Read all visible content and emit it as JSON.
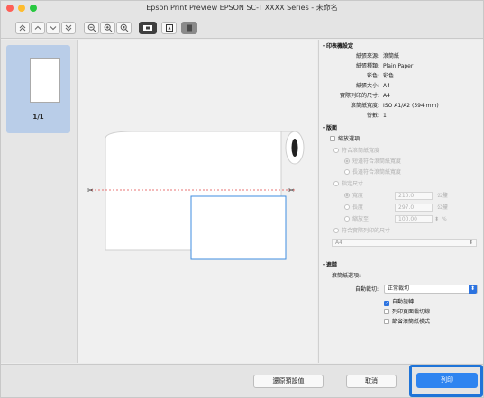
{
  "window": {
    "title": "Epson Print Preview EPSON SC-T XXXX Series - 未命名",
    "traffic_light_colors": [
      "#fe5f57",
      "#febc2e",
      "#28c840"
    ]
  },
  "toolbar": {
    "buttons": [
      "first-page",
      "previous-page",
      "next-page",
      "last-page",
      "zoom-out",
      "zoom-in",
      "zoom-fit",
      "roll-view",
      "page-view",
      "dark-view"
    ]
  },
  "thumbnails": [
    {
      "label": "1/1",
      "selected": true
    }
  ],
  "printer_settings": {
    "header": "印表機設定",
    "rows": [
      {
        "label": "紙張來源:",
        "value": "滾筒紙"
      },
      {
        "label": "紙張種類:",
        "value": "Plain Paper"
      },
      {
        "label": "彩色:",
        "value": "彩色"
      },
      {
        "label": "紙張大小:",
        "value": "A4"
      },
      {
        "label": "實際列印的尺寸:",
        "value": "A4"
      },
      {
        "label": "滾筒紙寬度:",
        "value": "ISO A1/A2 (594 mm)"
      },
      {
        "label": "份數:",
        "value": "1"
      }
    ]
  },
  "layout": {
    "header": "版面",
    "scaling_checkbox": "縮放選項",
    "scaling_checked": false,
    "fit_roll_width": "符合滾筒紙寬度",
    "fit_short_side": "短邊符合滾筒紙寬度",
    "fit_long_side": "長邊符合滾筒紙寬度",
    "specify_size": "指定尺寸",
    "width_label": "寬度",
    "width_value": "210.0",
    "width_unit": "公釐",
    "length_label": "長度",
    "length_value": "297.0",
    "length_unit": "公釐",
    "scale_label": "縮放至",
    "scale_value": "100.00",
    "scale_unit": "%",
    "fit_actual": "符合實際列印的尺寸",
    "actual_size_value": "A4"
  },
  "advanced": {
    "header": "進階",
    "roll_options": "滾筒紙選項:",
    "auto_cut_label": "自動裁切:",
    "auto_cut_value": "正常裁切",
    "auto_rotate": "自動旋轉",
    "auto_rotate_checked": true,
    "print_cut_line": "列印頁面裁切線",
    "print_cut_line_checked": false,
    "save_roll": "節省滾筒紙模式",
    "save_roll_checked": false
  },
  "footer": {
    "restore_defaults": "還原預設值",
    "cancel": "取消",
    "print": "列印"
  },
  "colors": {
    "accent": "#2e84f0",
    "highlight_frame": "#1f74d8",
    "cut_line": "#e34848",
    "page_outline": "#3f8ee0"
  }
}
